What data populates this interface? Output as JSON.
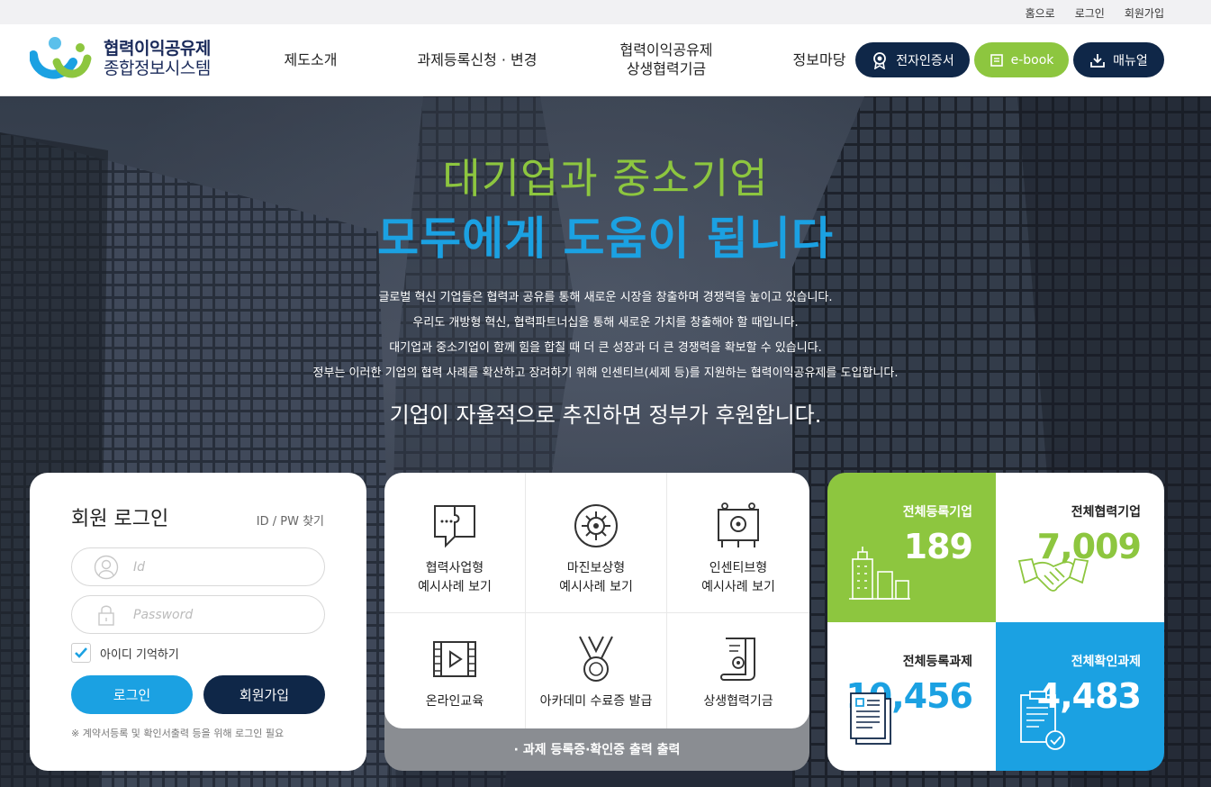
{
  "topbar": {
    "links": [
      "홈으로",
      "로그인",
      "회원가입"
    ]
  },
  "logo": {
    "line1": "협력이익공유제",
    "line2": "종합정보시스템"
  },
  "nav": {
    "items": [
      {
        "label": "제도소개"
      },
      {
        "label": "과제등록신청 · 변경"
      },
      {
        "line1": "협력이익공유제",
        "line2": "상생협력기금"
      },
      {
        "label": "정보마당"
      }
    ],
    "buttons": [
      {
        "label": "전자인증서",
        "icon": "certificate-icon",
        "color": "#0f2748"
      },
      {
        "label": "e-book",
        "icon": "book-icon",
        "color": "#8dc63f"
      },
      {
        "label": "매뉴얼",
        "icon": "download-icon",
        "color": "#0f2748"
      }
    ]
  },
  "hero": {
    "title1": "대기업과 중소기업",
    "title2": "모두에게 도움이 됩니다",
    "paragraph": [
      "글로벌 혁신 기업들은 협력과 공유를 통해 새로운 시장을 창출하며 경쟁력을 높이고 있습니다.",
      "우리도 개방형 혁신, 협력파트너십을 통해 새로운 가치를 창출해야 할 때입니다.",
      "대기업과 중소기업이 함께 힘을 합칠 때 더 큰 성장과 더 큰 경쟁력을 확보할 수 있습니다.",
      "정부는 이러한 기업의 협력 사례를 확산하고 장려하기 위해 인센티브(세제 등)를 지원하는 협력이익공유제를 도입합니다."
    ],
    "subtitle": "기업이 자율적으로 추진하면 정부가 후원합니다.",
    "colors": {
      "green": "#8dc63f",
      "blue": "#1ba1e2"
    }
  },
  "login": {
    "title": "회원 로그인",
    "find": "ID / PW 찾기",
    "id_placeholder": "Id",
    "pw_placeholder": "Password",
    "remember": "아이디 기억하기",
    "remember_checked": true,
    "login_button": "로그인",
    "join_button": "회원가입",
    "note": "※ 계약서등록 및 확인서출력 등을 위해 로그인 필요"
  },
  "quick": {
    "items": [
      {
        "line1": "협력사업형",
        "line2": "예시사례 보기",
        "icon": "puzzle-chat-icon"
      },
      {
        "line1": "마진보상형",
        "line2": "예시사례 보기",
        "icon": "gear-circle-icon"
      },
      {
        "line1": "인센티브형",
        "line2": "예시사례 보기",
        "icon": "presentation-gear-icon"
      },
      {
        "line1": "온라인교육",
        "line2": "",
        "icon": "video-film-icon"
      },
      {
        "line1": "아카데미 수료증 발급",
        "line2": "",
        "icon": "medal-icon"
      },
      {
        "line1": "상생협력기금",
        "line2": "",
        "icon": "scroll-icon"
      }
    ],
    "footer": "· 과제 등록증·확인증 출력 출력"
  },
  "stats": [
    {
      "title": "전체등록기업",
      "value": "189",
      "icon": "buildings-icon"
    },
    {
      "title": "전체협력기업",
      "value": "7,009",
      "icon": "handshake-icon"
    },
    {
      "title": "전체등록과제",
      "value": "10,456",
      "icon": "documents-icon"
    },
    {
      "title": "전체확인과제",
      "value": "4,483",
      "icon": "clipboard-check-icon"
    }
  ],
  "stat_colors": {
    "green": "#8dc63f",
    "blue": "#1ba1e2",
    "navy": "#0f2748"
  }
}
